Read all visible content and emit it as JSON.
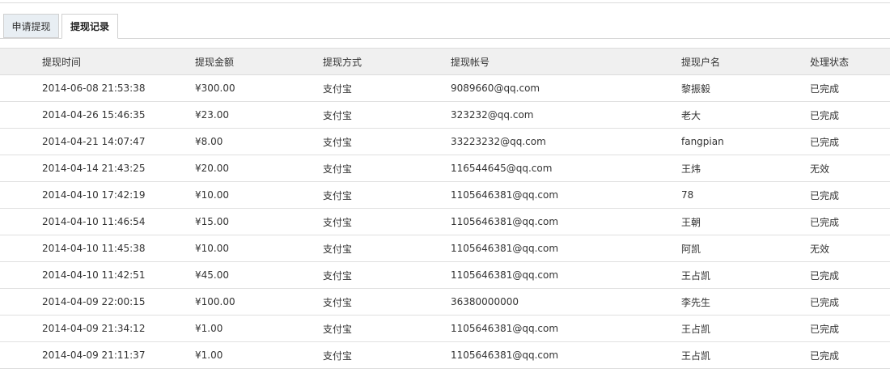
{
  "tabs": [
    {
      "label": "申请提现",
      "active": false
    },
    {
      "label": "提现记录",
      "active": true
    }
  ],
  "table": {
    "headers": [
      "提现时间",
      "提现金额",
      "提现方式",
      "提现帐号",
      "提现户名",
      "处理状态"
    ],
    "rows": [
      {
        "time": "2014-06-08 21:53:38",
        "amount": "¥300.00",
        "method": "支付宝",
        "account": "9089660@qq.com",
        "name": "黎振毅",
        "status": "已完成"
      },
      {
        "time": "2014-04-26 15:46:35",
        "amount": "¥23.00",
        "method": "支付宝",
        "account": "323232@qq.com",
        "name": "老大",
        "status": "已完成"
      },
      {
        "time": "2014-04-21 14:07:47",
        "amount": "¥8.00",
        "method": "支付宝",
        "account": "33223232@qq.com",
        "name": "fangpian",
        "status": "已完成"
      },
      {
        "time": "2014-04-14 21:43:25",
        "amount": "¥20.00",
        "method": "支付宝",
        "account": "116544645@qq.com",
        "name": "王炜",
        "status": "无效"
      },
      {
        "time": "2014-04-10 17:42:19",
        "amount": "¥10.00",
        "method": "支付宝",
        "account": "1105646381@qq.com",
        "name": "78",
        "status": "已完成"
      },
      {
        "time": "2014-04-10 11:46:54",
        "amount": "¥15.00",
        "method": "支付宝",
        "account": "1105646381@qq.com",
        "name": "王朝",
        "status": "已完成"
      },
      {
        "time": "2014-04-10 11:45:38",
        "amount": "¥10.00",
        "method": "支付宝",
        "account": "1105646381@qq.com",
        "name": "阿凯",
        "status": "无效"
      },
      {
        "time": "2014-04-10 11:42:51",
        "amount": "¥45.00",
        "method": "支付宝",
        "account": "1105646381@qq.com",
        "name": "王占凯",
        "status": "已完成"
      },
      {
        "time": "2014-04-09 22:00:15",
        "amount": "¥100.00",
        "method": "支付宝",
        "account": "36380000000",
        "name": "李先生",
        "status": "已完成"
      },
      {
        "time": "2014-04-09 21:34:12",
        "amount": "¥1.00",
        "method": "支付宝",
        "account": "1105646381@qq.com",
        "name": "王占凯",
        "status": "已完成"
      },
      {
        "time": "2014-04-09 21:11:37",
        "amount": "¥1.00",
        "method": "支付宝",
        "account": "1105646381@qq.com",
        "name": "王占凯",
        "status": "已完成"
      }
    ]
  },
  "colors": {
    "status_done": "#1e8a1e",
    "status_invalid": "#333333",
    "header_bg": "#f0f0f0",
    "active_tab_bg": "#ffffff",
    "inactive_tab_bg": "#e8eef3"
  }
}
